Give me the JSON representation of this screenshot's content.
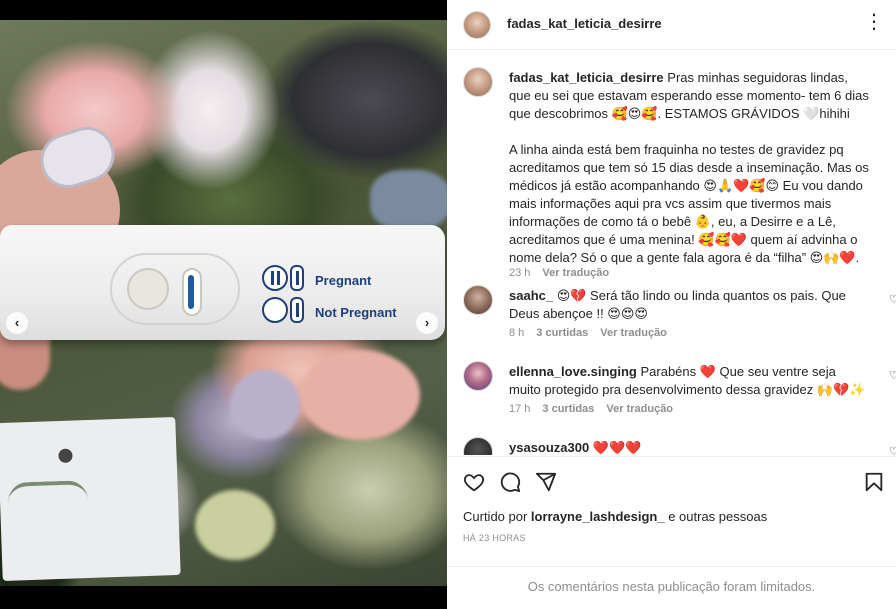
{
  "post": {
    "username": "fadas_kat_leticia_desirre",
    "more_icon": "more-options-icon"
  },
  "media": {
    "test_label_pregnant": "Pregnant",
    "test_label_not_pregnant": "Not Pregnant",
    "carousel_dots": 3,
    "carousel_active": 1
  },
  "caption": {
    "username": "fadas_kat_leticia_desirre",
    "text": " Pras minhas seguidoras lindas, que eu sei que estavam esperando esse momento- tem 6 dias que descobrimos 🥰😍🥰. ESTAMOS GRÁVIDOS 🤍hihihi\n\nA linha ainda está bem fraquinha no testes de gravidez pq acreditamos que tem só 15 dias desde a inseminação. Mas os médicos já estão acompanhando 😍🙏❤️🥰😊 Eu vou dando mais informações aqui pra vcs assim que tivermos mais informações de como tá o bebê 👶, eu, a Desirre e a Lê, acreditamos que é uma menina! 🥰🥰❤️ quem aí advinha o nome dela? Só o que a gente fala agora é da “filha” 😍🙌❤️.",
    "age": "23 h",
    "see_translation": "Ver tradução"
  },
  "comments": [
    {
      "username": "saahc_",
      "text": " 😍💔 Será tão lindo ou linda quantos os pais. Que Deus abençoe !! 😍😍😍",
      "age": "8 h",
      "likes": "3 curtidas",
      "see_translation": "Ver tradução"
    },
    {
      "username": "ellenna_love.singing",
      "text": " Parabéns ❤️ Que seu ventre seja muito protegido pra desenvolvimento dessa gravidez 🙌💔✨",
      "age": "17 h",
      "likes": "3 curtidas",
      "see_translation": "Ver tradução"
    },
    {
      "username": "ysasouza300",
      "text": " ❤️❤️❤️"
    }
  ],
  "actions": {
    "like_icon": "heart-icon",
    "comment_icon": "comment-icon",
    "share_icon": "share-icon",
    "save_icon": "bookmark-icon"
  },
  "likes": {
    "prefix": "Curtido por ",
    "user": "lorrayne_lashdesign_",
    "suffix": " e outras pessoas"
  },
  "timestamp": "HÁ 23 HORAS",
  "comments_limited": "Os comentários nesta publicação foram limitados."
}
